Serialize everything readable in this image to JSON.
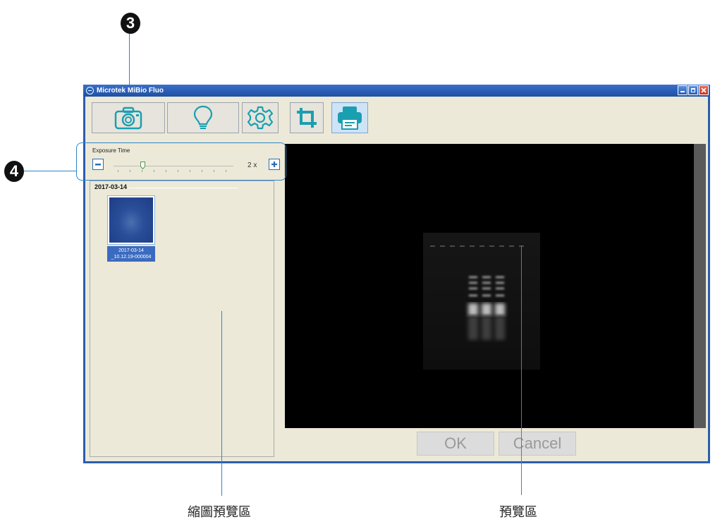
{
  "callouts": [
    {
      "label": "3"
    },
    {
      "label": "4"
    }
  ],
  "captions": {
    "thumbnail_area": "縮圖預覽區",
    "preview_area": "預覽區"
  },
  "window": {
    "title": "Microtek MiBio Fluo",
    "controls": [
      "minimize",
      "maximize",
      "close"
    ]
  },
  "toolbar": {
    "buttons": [
      {
        "icon": "camera-icon",
        "state": "normal"
      },
      {
        "icon": "bulb-icon",
        "state": "normal"
      },
      {
        "icon": "gear-icon",
        "state": "normal"
      },
      {
        "icon": "crop-icon",
        "state": "normal"
      },
      {
        "icon": "printer-icon",
        "state": "selected"
      }
    ]
  },
  "exposure": {
    "label": "Exposure Time",
    "value": "2 x",
    "decrease_icon": "minus-icon",
    "increase_icon": "plus-icon"
  },
  "thumbnails": {
    "date_group": "2017-03-14",
    "items": [
      {
        "caption_line1": "2017-03-14",
        "caption_line2": "_10.12.19-000004",
        "selected": true
      }
    ]
  },
  "dialog_buttons": {
    "ok": "OK",
    "cancel": "Cancel"
  },
  "colors": {
    "accent": "#2f86c7",
    "icon_teal": "#1a9fb0",
    "title_bar": "#2a5db0",
    "client_bg": "#ece9d8"
  }
}
